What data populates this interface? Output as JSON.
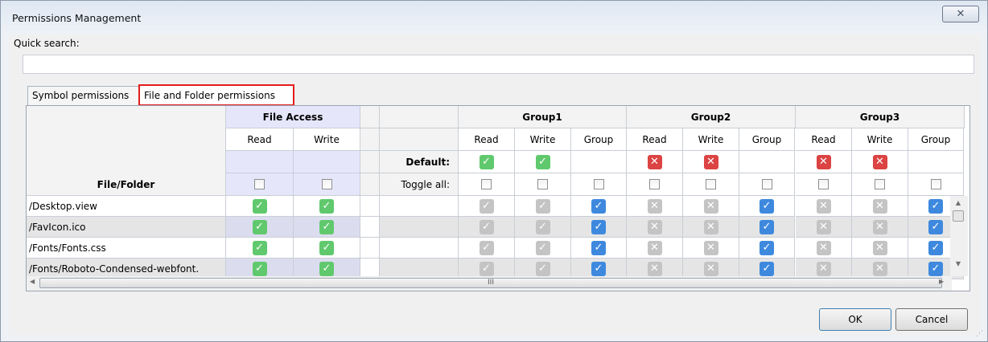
{
  "window": {
    "title": "Permissions Management",
    "close_glyph": "✕"
  },
  "quick_search": {
    "label": "Quick search:",
    "value": ""
  },
  "tabs": [
    {
      "label": "Symbol permissions",
      "active": false
    },
    {
      "label": "File and Folder permissions",
      "active": true
    }
  ],
  "grid": {
    "file_access_header": "File Access",
    "read_label": "Read",
    "write_label": "Write",
    "group_label": "Group",
    "groups": [
      "Group1",
      "Group2",
      "Group3"
    ],
    "default_label": "Default:",
    "toggle_all_label": "Toggle all:",
    "file_folder_header": "File/Folder",
    "defaults": [
      {
        "read": "allow",
        "write": "allow"
      },
      {
        "read": "deny",
        "write": "deny"
      },
      {
        "read": "deny",
        "write": "deny"
      }
    ],
    "rows": [
      {
        "path": "/Desktop.view",
        "fa_read": true,
        "fa_write": true,
        "groups": [
          {
            "read": "inherit-allow",
            "write": "inherit-allow",
            "group": true
          },
          {
            "read": "inherit-deny",
            "write": "inherit-deny",
            "group": true
          },
          {
            "read": "inherit-deny",
            "write": "inherit-deny",
            "group": true
          }
        ]
      },
      {
        "path": "/FavIcon.ico",
        "fa_read": true,
        "fa_write": true,
        "groups": [
          {
            "read": "inherit-allow",
            "write": "inherit-allow",
            "group": true
          },
          {
            "read": "inherit-deny",
            "write": "inherit-deny",
            "group": true
          },
          {
            "read": "inherit-deny",
            "write": "inherit-deny",
            "group": true
          }
        ]
      },
      {
        "path": "/Fonts/Fonts.css",
        "fa_read": true,
        "fa_write": true,
        "groups": [
          {
            "read": "inherit-allow",
            "write": "inherit-allow",
            "group": true
          },
          {
            "read": "inherit-deny",
            "write": "inherit-deny",
            "group": true
          },
          {
            "read": "inherit-deny",
            "write": "inherit-deny",
            "group": true
          }
        ]
      },
      {
        "path": "/Fonts/Roboto-Condensed-webfont.",
        "fa_read": true,
        "fa_write": true,
        "groups": [
          {
            "read": "inherit-allow",
            "write": "inherit-allow",
            "group": true
          },
          {
            "read": "inherit-deny",
            "write": "inherit-deny",
            "group": true
          },
          {
            "read": "inherit-deny",
            "write": "inherit-deny",
            "group": true
          }
        ]
      }
    ]
  },
  "hscroll_thumb_glyph": "III",
  "buttons": {
    "ok": "OK",
    "cancel": "Cancel"
  },
  "colors": {
    "allow": "#60c96d",
    "deny": "#dc4343",
    "group": "#3e89de",
    "inherit": "#c4c4c4",
    "tab_highlight": "#e31b1b"
  }
}
